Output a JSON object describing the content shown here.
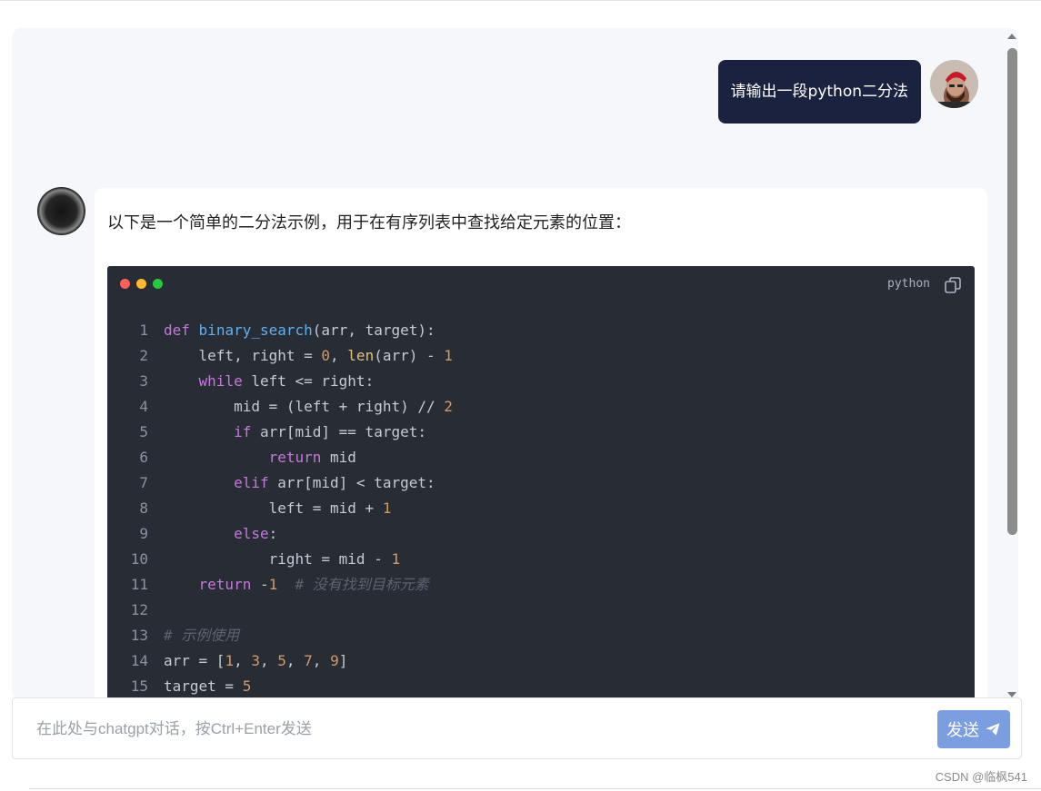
{
  "user_message": {
    "text": "请输出一段python二分法",
    "avatar": "user-avatar-photo"
  },
  "assistant_message": {
    "avatar": "assistant-avatar",
    "intro": "以下是一个简单的二分法示例，用于在有序列表中查找给定元素的位置："
  },
  "code_block": {
    "language": "python",
    "copy_icon": "copy-icon",
    "window_dots": [
      "#fe5f57",
      "#febc2e",
      "#28c840"
    ],
    "lines": [
      {
        "n": "1",
        "tokens": [
          {
            "t": "kw",
            "v": "def"
          },
          {
            "t": "pl",
            "v": " "
          },
          {
            "t": "fn",
            "v": "binary_search"
          },
          {
            "t": "pl",
            "v": "(arr, target):"
          }
        ]
      },
      {
        "n": "2",
        "tokens": [
          {
            "t": "pl",
            "v": "    left, right = "
          },
          {
            "t": "num",
            "v": "0"
          },
          {
            "t": "pl",
            "v": ", "
          },
          {
            "t": "bi",
            "v": "len"
          },
          {
            "t": "pl",
            "v": "(arr) - "
          },
          {
            "t": "num",
            "v": "1"
          }
        ]
      },
      {
        "n": "3",
        "tokens": [
          {
            "t": "pl",
            "v": "    "
          },
          {
            "t": "kw",
            "v": "while"
          },
          {
            "t": "pl",
            "v": " left <= right:"
          }
        ]
      },
      {
        "n": "4",
        "tokens": [
          {
            "t": "pl",
            "v": "        mid = (left + right) // "
          },
          {
            "t": "num",
            "v": "2"
          }
        ]
      },
      {
        "n": "5",
        "tokens": [
          {
            "t": "pl",
            "v": "        "
          },
          {
            "t": "kw",
            "v": "if"
          },
          {
            "t": "pl",
            "v": " arr[mid] == target:"
          }
        ]
      },
      {
        "n": "6",
        "tokens": [
          {
            "t": "pl",
            "v": "            "
          },
          {
            "t": "kw",
            "v": "return"
          },
          {
            "t": "pl",
            "v": " mid"
          }
        ]
      },
      {
        "n": "7",
        "tokens": [
          {
            "t": "pl",
            "v": "        "
          },
          {
            "t": "kw",
            "v": "elif"
          },
          {
            "t": "pl",
            "v": " arr[mid] < target:"
          }
        ]
      },
      {
        "n": "8",
        "tokens": [
          {
            "t": "pl",
            "v": "            left = mid + "
          },
          {
            "t": "num",
            "v": "1"
          }
        ]
      },
      {
        "n": "9",
        "tokens": [
          {
            "t": "pl",
            "v": "        "
          },
          {
            "t": "kw",
            "v": "else"
          },
          {
            "t": "pl",
            "v": ":"
          }
        ]
      },
      {
        "n": "10",
        "tokens": [
          {
            "t": "pl",
            "v": "            right = mid - "
          },
          {
            "t": "num",
            "v": "1"
          }
        ]
      },
      {
        "n": "11",
        "tokens": [
          {
            "t": "pl",
            "v": "    "
          },
          {
            "t": "kw",
            "v": "return"
          },
          {
            "t": "pl",
            "v": " -"
          },
          {
            "t": "num",
            "v": "1"
          },
          {
            "t": "pl",
            "v": "  "
          },
          {
            "t": "cm",
            "v": "# 没有找到目标元素"
          }
        ]
      },
      {
        "n": "12",
        "tokens": []
      },
      {
        "n": "13",
        "tokens": [
          {
            "t": "cm",
            "v": "# 示例使用"
          }
        ]
      },
      {
        "n": "14",
        "tokens": [
          {
            "t": "pl",
            "v": "arr = ["
          },
          {
            "t": "num",
            "v": "1"
          },
          {
            "t": "pl",
            "v": ", "
          },
          {
            "t": "num",
            "v": "3"
          },
          {
            "t": "pl",
            "v": ", "
          },
          {
            "t": "num",
            "v": "5"
          },
          {
            "t": "pl",
            "v": ", "
          },
          {
            "t": "num",
            "v": "7"
          },
          {
            "t": "pl",
            "v": ", "
          },
          {
            "t": "num",
            "v": "9"
          },
          {
            "t": "pl",
            "v": "]"
          }
        ]
      },
      {
        "n": "15",
        "tokens": [
          {
            "t": "pl",
            "v": "target = "
          },
          {
            "t": "num",
            "v": "5"
          }
        ]
      }
    ]
  },
  "composer": {
    "placeholder": "在此处与chatgpt对话，按Ctrl+Enter发送",
    "value": "",
    "send_label": "发送",
    "send_icon": "paper-plane-icon"
  },
  "watermark": "CSDN @临枫541",
  "colors": {
    "user_bubble": "#1b2240",
    "send_button": "#7b9ee0",
    "code_background": "#282c34",
    "chat_background": "#f5f7fb"
  }
}
